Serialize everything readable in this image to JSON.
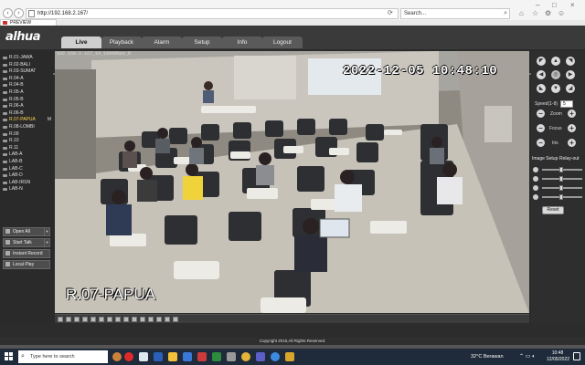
{
  "browser": {
    "url": "http://192.168.2.167/",
    "search_placeholder": "Search...",
    "tab_title": "PREVIEW"
  },
  "app": {
    "logo": "alhua",
    "nav": [
      "Live",
      "Playback",
      "Alarm",
      "Setup",
      "Info",
      "Logout"
    ],
    "active_nav": "Live"
  },
  "channels": [
    {
      "label": "R.01-JAWA"
    },
    {
      "label": "R.02-BALI"
    },
    {
      "label": "R.03-SUMAT"
    },
    {
      "label": "R.04-A"
    },
    {
      "label": "R.04-B"
    },
    {
      "label": "R.05-A"
    },
    {
      "label": "R.05-B"
    },
    {
      "label": "R.06-A"
    },
    {
      "label": "R.06-B"
    },
    {
      "label": "R.07-PAPUA",
      "marker": "M"
    },
    {
      "label": "R.08-LOMBI"
    },
    {
      "label": "R.09"
    },
    {
      "label": "R.10"
    },
    {
      "label": "R.11"
    },
    {
      "label": "LAB-A"
    },
    {
      "label": "LAB-B"
    },
    {
      "label": "LAB-C"
    },
    {
      "label": "LAB-D"
    },
    {
      "label": "LAB-IRSN"
    },
    {
      "label": "LAB-N"
    }
  ],
  "active_channel": "R.07-PAPUA",
  "side_buttons": {
    "open_all": "Open All",
    "start_talk": "Start Talk",
    "instant_record": "Instant Record",
    "local_play": "Local Play"
  },
  "video": {
    "caption": "192.168.2.167_10_18098bps_R",
    "timestamp": "2022-12-05 10:48:10",
    "channel_label": "R.07-PAPUA"
  },
  "ptz": {
    "speed_label": "Speed(1-8)",
    "speed_value": "5",
    "zoom_label": "Zoom",
    "focus_label": "Focus",
    "iris_label": "Iris",
    "image_setup_label": "Image Setup",
    "relay_out_label": "Relay-out",
    "reset_label": "Reset",
    "sliders": [
      0.45,
      0.45,
      0.45,
      0.45
    ]
  },
  "footer": {
    "copyright": "Copyright 2015,All Rights Reserved."
  },
  "taskbar": {
    "search_placeholder": "Type here to search",
    "weather": "32°C  Berawan",
    "time": "10:48",
    "date": "12/05/2022"
  }
}
